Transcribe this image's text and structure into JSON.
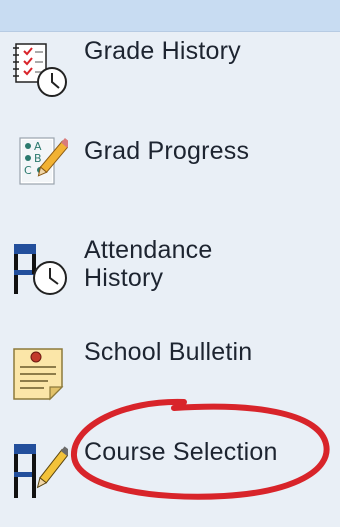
{
  "menu": {
    "items": [
      {
        "id": "grade-history",
        "label": "Grade History",
        "icon": "grade-history-icon"
      },
      {
        "id": "grad-progress",
        "label": "Grad Progress",
        "icon": "grad-progress-icon"
      },
      {
        "id": "attendance-history",
        "label_line1": "Attendance",
        "label_line2": "History",
        "icon": "attendance-history-icon"
      },
      {
        "id": "school-bulletin",
        "label": "School Bulletin",
        "icon": "school-bulletin-icon"
      },
      {
        "id": "course-selection",
        "label": "Course Selection",
        "icon": "course-selection-icon",
        "highlighted": true
      }
    ]
  },
  "colors": {
    "background": "#e9eff6",
    "header_bar": "#c8dcf2",
    "text": "#1d2430",
    "highlight_ring": "#d8242a",
    "icon_blue": "#234f9c"
  }
}
